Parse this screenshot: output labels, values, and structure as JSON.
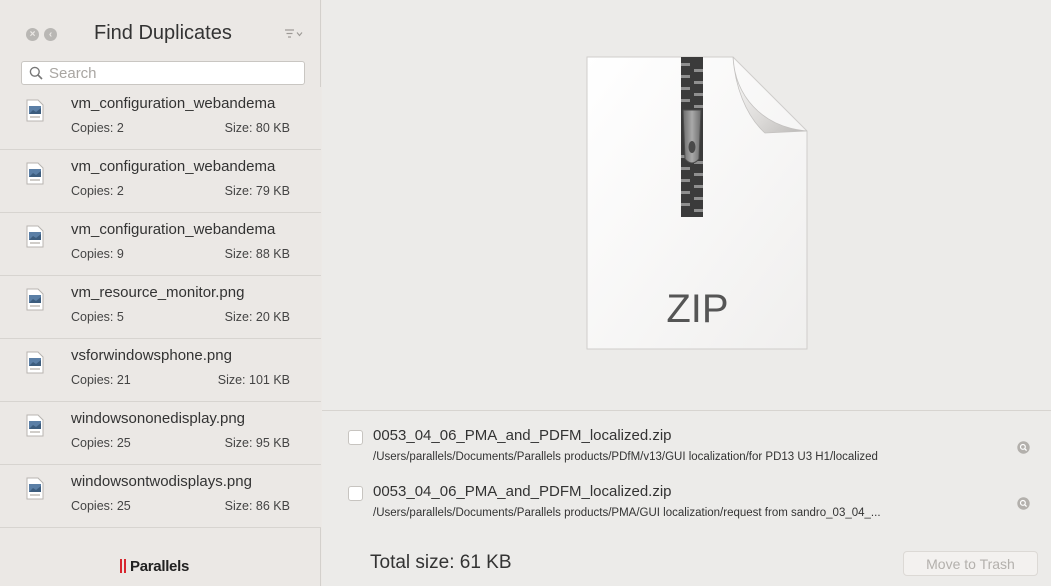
{
  "sidebar": {
    "title": "Find Duplicates",
    "search_placeholder": "Search",
    "items": [
      {
        "name": "vm_configuration_webandema",
        "copies": "Copies: 2",
        "size": "Size: 80 KB"
      },
      {
        "name": "vm_configuration_webandema",
        "copies": "Copies: 2",
        "size": "Size: 79 KB"
      },
      {
        "name": "vm_configuration_webandema",
        "copies": "Copies: 9",
        "size": "Size: 88 KB"
      },
      {
        "name": "vm_resource_monitor.png",
        "copies": "Copies: 5",
        "size": "Size: 20 KB"
      },
      {
        "name": "vsforwindowsphone.png",
        "copies": "Copies: 21",
        "size": "Size: 101 KB"
      },
      {
        "name": "windowsononedisplay.png",
        "copies": "Copies: 25",
        "size": "Size: 95 KB"
      },
      {
        "name": "windowsontwodisplays.png",
        "copies": "Copies: 25",
        "size": "Size: 86 KB"
      }
    ],
    "logo_text": "Parallels"
  },
  "preview": {
    "label": "ZIP"
  },
  "duplicates": [
    {
      "name": "0053_04_06_PMA_and_PDFM_localized.zip",
      "path": "/Users/parallels/Documents/Parallels products/PDfM/v13/GUI localization/for PD13 U3 H1/localized",
      "checked": false
    },
    {
      "name": "0053_04_06_PMA_and_PDFM_localized.zip",
      "path": "/Users/parallels/Documents/Parallels products/PMA/GUI localization/request from sandro_03_04_...",
      "checked": false
    }
  ],
  "footer": {
    "total_size": "Total size: 61 KB",
    "trash_label": "Move to Trash"
  },
  "colors": {
    "brand_red": "#d7262e",
    "sidebar_bg": "#ebe8e5",
    "main_bg": "#ecebe9"
  }
}
